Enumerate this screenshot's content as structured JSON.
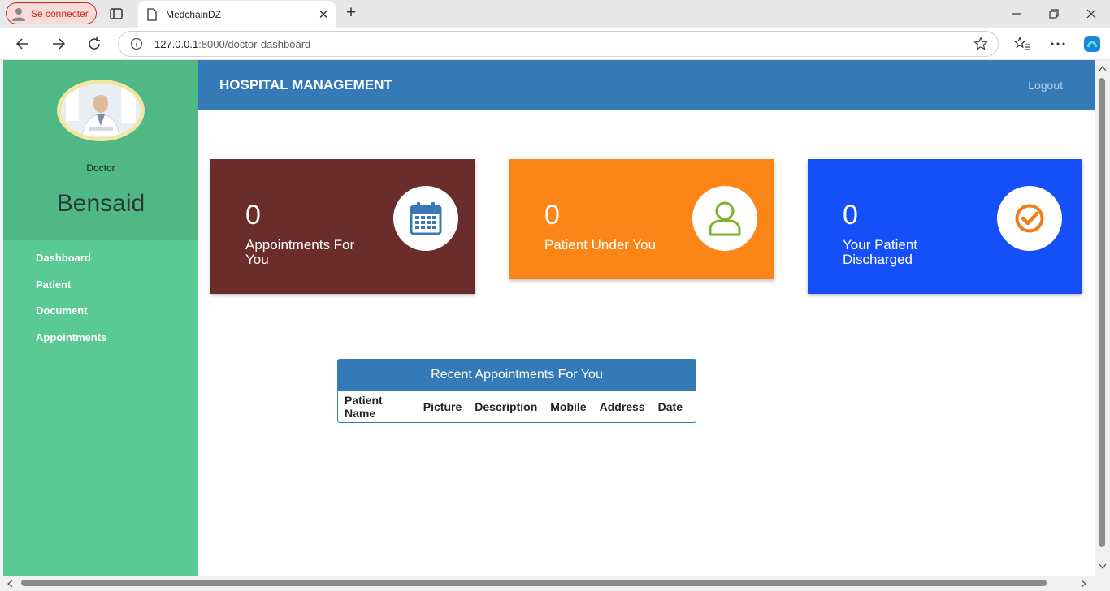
{
  "browser": {
    "profile_label": "Se connecter",
    "tab_title": "MedchainDZ",
    "url_host": "127.0.0.1",
    "url_path": ":8000/doctor-dashboard"
  },
  "sidebar": {
    "role": "Doctor",
    "name": "Bensaid",
    "items": [
      {
        "label": "Dashboard"
      },
      {
        "label": "Patient"
      },
      {
        "label": "Document"
      },
      {
        "label": "Appointments"
      }
    ]
  },
  "header": {
    "title": "HOSPITAL MANAGEMENT",
    "logout": "Logout"
  },
  "cards": [
    {
      "value": "0",
      "label": "Appointments For You",
      "color": "#6b2c2c",
      "icon": "calendar-icon",
      "icon_color": "#3a78b5"
    },
    {
      "value": "0",
      "label": "Patient Under You",
      "color": "#fc8517",
      "icon": "user-icon",
      "icon_color": "#7bb12c"
    },
    {
      "value": "0",
      "label": "Your Patient Discharged",
      "color": "#154ff7",
      "icon": "check-circle-icon",
      "icon_color": "#f07d1a"
    }
  ],
  "recent": {
    "title": "Recent Appointments For You",
    "columns": [
      "Patient Name",
      "Picture",
      "Description",
      "Mobile",
      "Address",
      "Date"
    ]
  },
  "colors": {
    "sidebar": "#5bc994",
    "sidebar_head": "#4fb884",
    "header": "#337ab7"
  }
}
